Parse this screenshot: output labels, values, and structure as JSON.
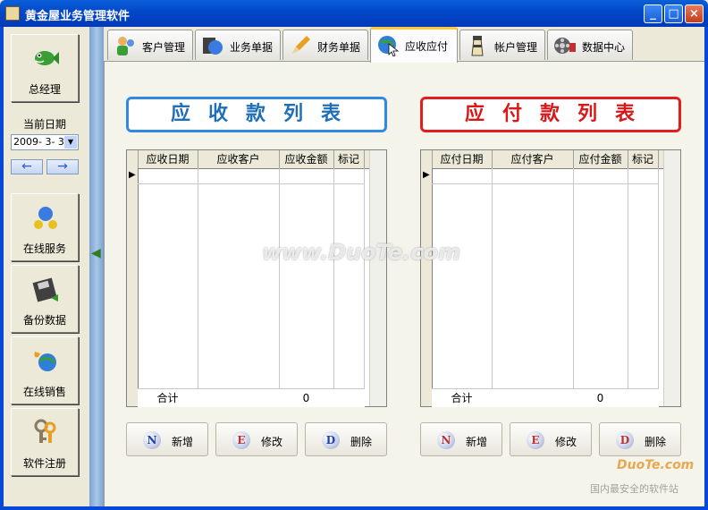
{
  "window": {
    "title": "黄金屋业务管理软件"
  },
  "sidebar": {
    "items": [
      {
        "label": "总经理",
        "icon": "fish-icon"
      },
      {
        "label": "在线服务",
        "icon": "online-service-icon"
      },
      {
        "label": "备份数据",
        "icon": "floppy-disk-icon"
      },
      {
        "label": "在线销售",
        "icon": "phone-globe-icon"
      },
      {
        "label": "软件注册",
        "icon": "keys-icon"
      }
    ],
    "date_label": "当前日期",
    "date_value": "2009- 3- 3"
  },
  "tabs": [
    {
      "label": "客户管理",
      "icon": "customer-icon",
      "active": false
    },
    {
      "label": "业务单据",
      "icon": "globe-book-icon",
      "active": false
    },
    {
      "label": "财务单据",
      "icon": "pencil-icon",
      "active": false
    },
    {
      "label": "应收应付",
      "icon": "globe-cursor-icon",
      "active": true
    },
    {
      "label": "帐户管理",
      "icon": "lighthouse-icon",
      "active": false
    },
    {
      "label": "数据中心",
      "icon": "film-reel-icon",
      "active": false
    }
  ],
  "receivable": {
    "title": "应收款列表",
    "columns": [
      "应收日期",
      "应收客户",
      "应收金额",
      "标记"
    ],
    "footer": {
      "label": "合计",
      "total": "0"
    },
    "buttons": [
      {
        "letter": "N",
        "label": "新增"
      },
      {
        "letter": "E",
        "label": "修改"
      },
      {
        "letter": "D",
        "label": "删除"
      }
    ]
  },
  "payable": {
    "title": "应付款列表",
    "columns": [
      "应付日期",
      "应付客户",
      "应付金额",
      "标记"
    ],
    "footer": {
      "label": "合计",
      "total": "0"
    },
    "buttons": [
      {
        "letter": "N",
        "label": "新增"
      },
      {
        "letter": "E",
        "label": "修改"
      },
      {
        "letter": "D",
        "label": "删除"
      }
    ]
  },
  "watermark": {
    "center_text": "www.DuoTe.com",
    "corner_text": "DuoTe.com",
    "corner_caption": "国内最安全的软件站"
  },
  "colors": {
    "titlebar": "#0347c9",
    "receivable_accent": "#2f8ae6",
    "payable_accent": "#e02020"
  }
}
